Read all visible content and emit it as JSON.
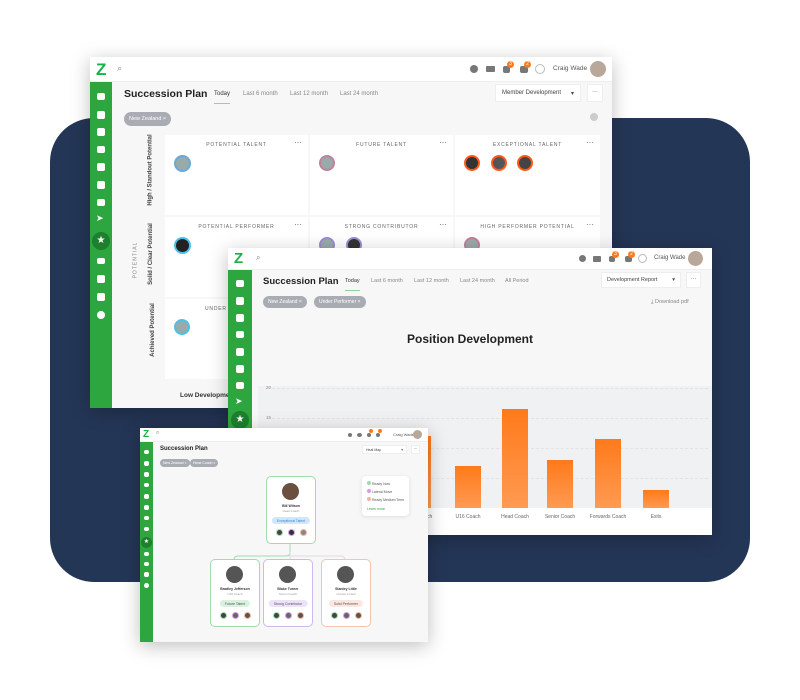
{
  "user": {
    "name": "Craig Wade"
  },
  "colors": {
    "brand_green": "#2ea63f",
    "accent_orange": "#ff7a1a",
    "background_navy": "#243656"
  },
  "window1": {
    "title": "Succession Plan",
    "tabs": [
      "Today",
      "Last 6 month",
      "Last 12 month",
      "Last 24 month"
    ],
    "active_tab": "Today",
    "dropdown": "Member Development",
    "notifications": {
      "alerts": "3",
      "messages": "2"
    },
    "filters": [
      "New Zealand ×"
    ],
    "axis_label": "POTENTIAL",
    "row_labels": [
      "High / Standout Potential",
      "Solid / Clear Potential",
      "Achieved Potential"
    ],
    "cells": [
      "POTENTIAL TALENT",
      "FUTURE TALENT",
      "EXCEPTIONAL TALENT",
      "POTENTIAL PERFORMER",
      "STRONG CONTRIBUTOR",
      "HIGH PERFORMER POTENTIAL",
      "UNDER"
    ],
    "column_label": "Low Development"
  },
  "window2": {
    "title": "Succession Plan",
    "tabs": [
      "Today",
      "Last 6 month",
      "Last 12 month",
      "Last 24 month",
      "All Period"
    ],
    "active_tab": "Today",
    "dropdown": "Development Report",
    "filters": [
      "New Zealand ×",
      "Under Performer ×"
    ],
    "download": "Download pdf"
  },
  "chart_data": {
    "type": "bar",
    "title": "Position Development",
    "categories": [
      "...rum Coach",
      "U16 Coach",
      "Head Coach",
      "Senior Coach",
      "Forwards Coach",
      "Exits"
    ],
    "values": [
      12,
      7,
      16.5,
      8,
      11.5,
      3
    ],
    "y_ticks": [
      "20",
      "15"
    ],
    "ylim": [
      0,
      20
    ],
    "grid": true,
    "color": "#ff7a1a"
  },
  "window3": {
    "title": "Succession Plan",
    "dropdown": "Heat Map",
    "filters": [
      "New Zealand ×",
      "Head Coach ×"
    ],
    "legend": [
      "Ready Now",
      "Lateral Move",
      "Ready Medium Term"
    ],
    "legend_colors": [
      "#9fdcae",
      "#d99be8",
      "#f6b49a"
    ],
    "learn_more": "Learn more",
    "root": {
      "name": "Bill Wilson",
      "role": "Head Coach",
      "tag": "Exceptional Talent"
    },
    "children": [
      {
        "name": "Bradley Jefferson",
        "role": "U16 Coach",
        "tag": "Future Talent",
        "color": "#9fdcae"
      },
      {
        "name": "Blake Turner",
        "role": "Scrum Coach",
        "tag": "Strong Contributor",
        "color": "#d2b6f0"
      },
      {
        "name": "Stanley Little",
        "role": "Lineout Coach",
        "tag": "Solid Performer",
        "color": "#f6c3b0"
      }
    ]
  }
}
